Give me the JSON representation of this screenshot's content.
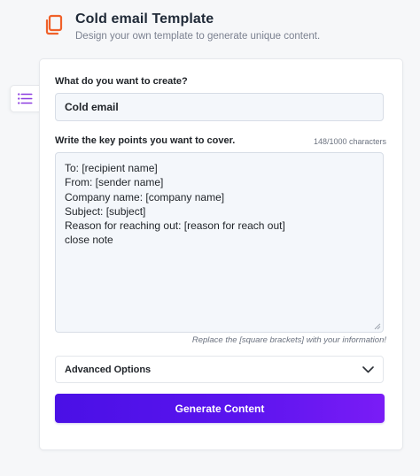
{
  "header": {
    "icon": "copy-document-icon",
    "title": "Cold email Template",
    "subtitle": "Design your own template to generate unique content."
  },
  "side_tab": {
    "icon": "list-menu-icon"
  },
  "form": {
    "create_label": "What do you want to create?",
    "create_value": "Cold email",
    "keypoints_label": "Write the key points you want to cover.",
    "char_counter": "148/1000 characters",
    "keypoints_lines": [
      "To: [recipient name]",
      "From: [sender name]",
      "Company name: [company name]",
      "Subject: [subject]",
      "Reason for reaching out: [reason for reach out]",
      "close note"
    ],
    "hint": "Replace the [square brackets] with your information!",
    "advanced_label": "Advanced Options",
    "generate_label": "Generate Content"
  },
  "colors": {
    "accent_orange": "#f0612a",
    "accent_purple": "#5a14ee",
    "menu_icon_purple": "#8b3be0"
  }
}
